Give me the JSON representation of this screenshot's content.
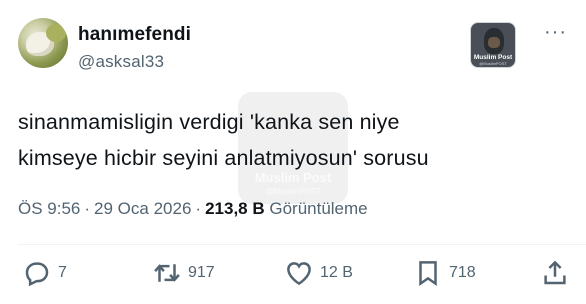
{
  "author": {
    "display_name": "hanımefendi",
    "handle": "@asksal33"
  },
  "source_badge": {
    "label": "Muslim Post",
    "sublabel": "@MuslimPOST"
  },
  "more_icon": "more-horizontal-icon",
  "tweet": {
    "lines": [
      "sinanmamisligin verdigi 'kanka sen niye",
      "kimseye hicbir seyini anlatmiyosun' sorusu"
    ]
  },
  "watermark": {
    "label": "Muslim Post",
    "sublabel": "@MuslimPOST"
  },
  "meta": {
    "time": "ÖS 9:56",
    "separator": "·",
    "date": "29 Oca 2026",
    "views_count": "213,8 B",
    "views_label": "Görüntüleme"
  },
  "actions": {
    "replies": "7",
    "reposts": "917",
    "likes": "12 B",
    "bookmarks": "718"
  },
  "colors": {
    "text_primary": "#0f1419",
    "text_secondary": "#536471",
    "divider": "#eff3f4"
  }
}
